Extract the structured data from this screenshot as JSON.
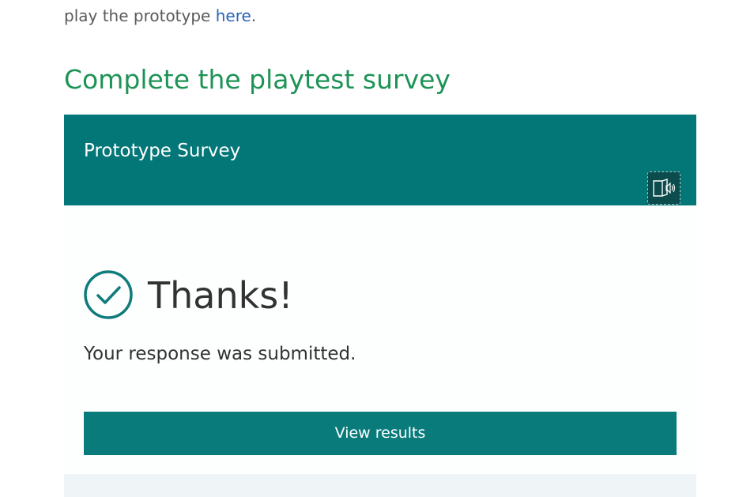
{
  "intro": {
    "text": "play the prototype ",
    "link_text": "here",
    "suffix": "."
  },
  "section_heading": "Complete the playtest survey",
  "survey": {
    "title": "Prototype Survey",
    "reader_icon": "immersive-reader-icon",
    "header_color": "#037677"
  },
  "confirmation": {
    "icon": "check-circle-icon",
    "heading": "Thanks!",
    "message": "Your response was submitted.",
    "button_label": "View results",
    "button_color": "#097b7b"
  },
  "colors": {
    "heading_green": "#1e9356",
    "link_blue": "#2a64b5"
  }
}
